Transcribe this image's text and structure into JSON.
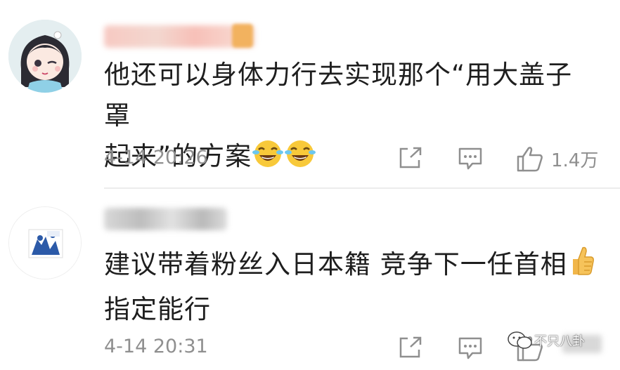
{
  "comments": [
    {
      "text_line1": "他还可以身体力行去实现那个“用大盖子罩",
      "text_line2": "起来”的方案",
      "emojis": [
        "laughing-tears-emoji",
        "laughing-tears-emoji"
      ],
      "timestamp": "4-14 20:26",
      "like_count": "1.4万",
      "icons": {
        "share": "share-icon",
        "reply": "comment-icon",
        "like": "thumbs-up-icon"
      }
    },
    {
      "text_line1": "建议带着粉丝入日本籍 竞争下一任首相",
      "text_line2": "指定能行",
      "emojis": [
        "thumbs-up-emoji"
      ],
      "timestamp": "4-14 20:31",
      "icons": {
        "share": "share-icon",
        "reply": "comment-icon",
        "like": "thumbs-up-icon"
      }
    }
  ],
  "watermark": {
    "text": "不只八卦",
    "icon": "wechat-icon"
  },
  "colors": {
    "meta_text": "#8f8f8f",
    "body_text": "#1e1e1e",
    "divider": "#ececec"
  }
}
